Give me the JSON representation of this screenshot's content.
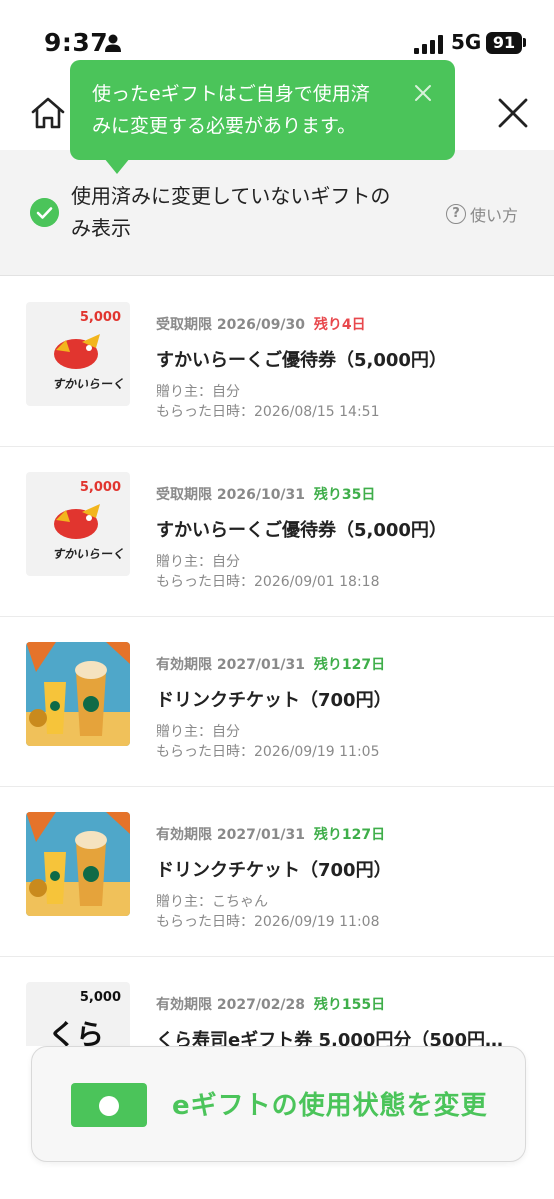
{
  "status_bar": {
    "time": "9:37",
    "network": "5G",
    "battery": "91"
  },
  "tooltip": {
    "text_line1": "使ったeギフトはご自身で使用済",
    "text_line2": "みに変更する必要があります。"
  },
  "filter": {
    "label_line1": "使用済みに変更していないギフトの",
    "label_line2": "み表示",
    "help_label": "使い方"
  },
  "gifts": [
    {
      "thumb_value": "5,000",
      "deadline_label": "受取期限",
      "deadline_date": "2026/09/30",
      "remaining": "残り4日",
      "remaining_color": "red",
      "title": "すかいらーくご優待券（5,000円）",
      "sender": "贈り主：自分",
      "received": "もらった日時：2026/08/15 14:51"
    },
    {
      "thumb_value": "5,000",
      "deadline_label": "受取期限",
      "deadline_date": "2026/10/31",
      "remaining": "残り35日",
      "remaining_color": "green",
      "title": "すかいらーくご優待券（5,000円）",
      "sender": "贈り主：自分",
      "received": "もらった日時：2026/09/01 18:18"
    },
    {
      "thumb_value": "",
      "deadline_label": "有効期限",
      "deadline_date": "2027/01/31",
      "remaining": "残り127日",
      "remaining_color": "green",
      "title": "ドリンクチケット（700円）",
      "sender": "贈り主：自分",
      "received": "もらった日時：2026/09/19 11:05"
    },
    {
      "thumb_value": "",
      "deadline_label": "有効期限",
      "deadline_date": "2027/01/31",
      "remaining": "残り127日",
      "remaining_color": "green",
      "title": "ドリンクチケット（700円）",
      "sender": "贈り主：こちゃん",
      "received": "もらった日時：2026/09/19 11:08"
    },
    {
      "thumb_value": "5,000",
      "deadline_label": "有効期限",
      "deadline_date": "2027/02/28",
      "remaining": "残り155日",
      "remaining_color": "green",
      "title": "くら寿司eギフト券 5,000円分（500円…",
      "sender": "",
      "received": ""
    }
  ],
  "action_button": {
    "label": "eギフトの使用状態を変更"
  },
  "colors": {
    "accent": "#4bc45a",
    "warning": "#e8484d"
  }
}
